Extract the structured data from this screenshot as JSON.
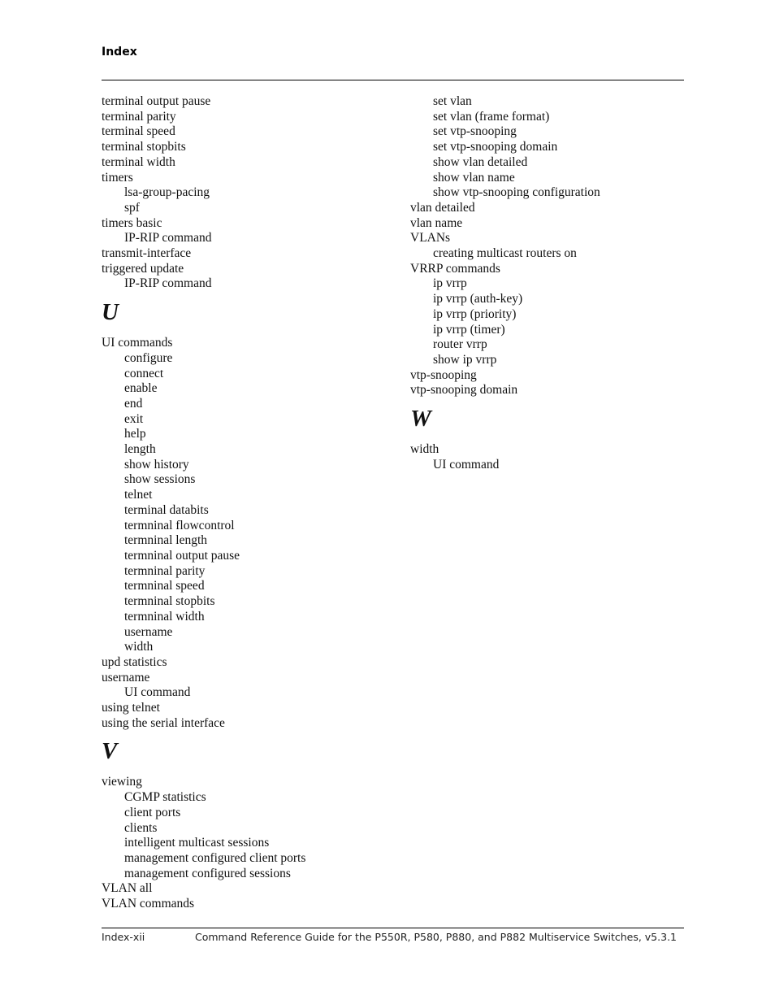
{
  "header": {
    "title": "Index"
  },
  "left_column": [
    {
      "type": "entry",
      "text": "terminal output pause"
    },
    {
      "type": "entry",
      "text": "terminal parity"
    },
    {
      "type": "entry",
      "text": "terminal speed"
    },
    {
      "type": "entry",
      "text": "terminal stopbits"
    },
    {
      "type": "entry",
      "text": "terminal width"
    },
    {
      "type": "entry",
      "text": "timers"
    },
    {
      "type": "sub",
      "text": "lsa-group-pacing"
    },
    {
      "type": "sub",
      "text": "spf"
    },
    {
      "type": "entry",
      "text": "timers basic"
    },
    {
      "type": "sub",
      "text": "IP-RIP command"
    },
    {
      "type": "entry",
      "text": "transmit-interface"
    },
    {
      "type": "entry",
      "text": "triggered update"
    },
    {
      "type": "sub",
      "text": "IP-RIP command"
    },
    {
      "type": "letter",
      "text": "U"
    },
    {
      "type": "entry",
      "text": "UI commands"
    },
    {
      "type": "sub",
      "text": "configure"
    },
    {
      "type": "sub",
      "text": "connect"
    },
    {
      "type": "sub",
      "text": "enable"
    },
    {
      "type": "sub",
      "text": "end"
    },
    {
      "type": "sub",
      "text": "exit"
    },
    {
      "type": "sub",
      "text": "help"
    },
    {
      "type": "sub",
      "text": "length"
    },
    {
      "type": "sub",
      "text": "show history"
    },
    {
      "type": "sub",
      "text": "show sessions"
    },
    {
      "type": "sub",
      "text": "telnet"
    },
    {
      "type": "sub",
      "text": "terminal databits"
    },
    {
      "type": "sub",
      "text": "termninal flowcontrol"
    },
    {
      "type": "sub",
      "text": "termninal length"
    },
    {
      "type": "sub",
      "text": "termninal output pause"
    },
    {
      "type": "sub",
      "text": "termninal parity"
    },
    {
      "type": "sub",
      "text": "termninal speed"
    },
    {
      "type": "sub",
      "text": "termninal stopbits"
    },
    {
      "type": "sub",
      "text": "termninal width"
    },
    {
      "type": "sub",
      "text": "username"
    },
    {
      "type": "sub",
      "text": "width"
    },
    {
      "type": "entry",
      "text": "upd statistics"
    },
    {
      "type": "entry",
      "text": "username"
    },
    {
      "type": "sub",
      "text": "UI command"
    },
    {
      "type": "entry",
      "text": "using telnet"
    },
    {
      "type": "entry",
      "text": "using the serial interface"
    },
    {
      "type": "letter",
      "text": "V"
    },
    {
      "type": "entry",
      "text": "viewing"
    },
    {
      "type": "sub",
      "text": "CGMP statistics"
    },
    {
      "type": "sub",
      "text": "client ports"
    },
    {
      "type": "sub",
      "text": "clients"
    },
    {
      "type": "sub",
      "text": "intelligent multicast sessions"
    },
    {
      "type": "sub",
      "text": "management configured client ports"
    },
    {
      "type": "sub",
      "text": "management configured sessions"
    },
    {
      "type": "entry",
      "text": "VLAN all"
    },
    {
      "type": "entry",
      "text": "VLAN commands"
    }
  ],
  "right_column": [
    {
      "type": "sub",
      "text": "set vlan"
    },
    {
      "type": "sub",
      "text": "set vlan (frame format)"
    },
    {
      "type": "sub",
      "text": "set vtp-snooping"
    },
    {
      "type": "sub",
      "text": "set vtp-snooping domain"
    },
    {
      "type": "sub",
      "text": "show vlan detailed"
    },
    {
      "type": "sub",
      "text": "show vlan name"
    },
    {
      "type": "sub",
      "text": "show vtp-snooping configuration"
    },
    {
      "type": "entry",
      "text": "vlan detailed"
    },
    {
      "type": "entry",
      "text": "vlan name"
    },
    {
      "type": "entry",
      "text": "VLANs"
    },
    {
      "type": "sub",
      "text": "creating multicast routers on"
    },
    {
      "type": "entry",
      "text": "VRRP commands"
    },
    {
      "type": "sub",
      "text": "ip vrrp"
    },
    {
      "type": "sub",
      "text": "ip vrrp (auth-key)"
    },
    {
      "type": "sub",
      "text": "ip vrrp (priority)"
    },
    {
      "type": "sub",
      "text": "ip vrrp (timer)"
    },
    {
      "type": "sub",
      "text": "router vrrp"
    },
    {
      "type": "sub",
      "text": "show ip vrrp"
    },
    {
      "type": "entry",
      "text": "vtp-snooping"
    },
    {
      "type": "entry",
      "text": "vtp-snooping domain"
    },
    {
      "type": "letter",
      "text": "W"
    },
    {
      "type": "entry",
      "text": "width"
    },
    {
      "type": "sub",
      "text": "UI command"
    }
  ],
  "footer": {
    "page_number": "Index-xii",
    "book_title": "Command Reference Guide for the P550R, P580, P880, and P882 Multiservice Switches, v5.3.1"
  }
}
